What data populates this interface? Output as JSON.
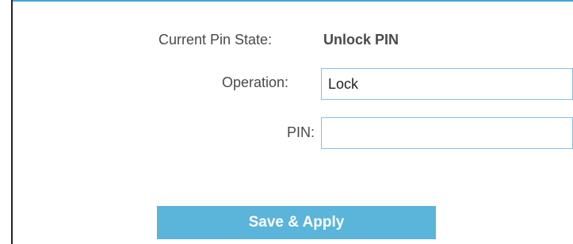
{
  "form": {
    "current_pin_state_label": "Current Pin State:",
    "current_pin_state_value": "Unlock PIN",
    "operation_label": "Operation:",
    "operation_value": "Lock",
    "pin_label": "PIN:",
    "pin_value": "",
    "save_button_label": "Save & Apply"
  },
  "colors": {
    "accent": "#3aa7d9",
    "button": "#5bb4d9",
    "field_border": "#7fc1e4",
    "text": "#4a4a4a"
  }
}
